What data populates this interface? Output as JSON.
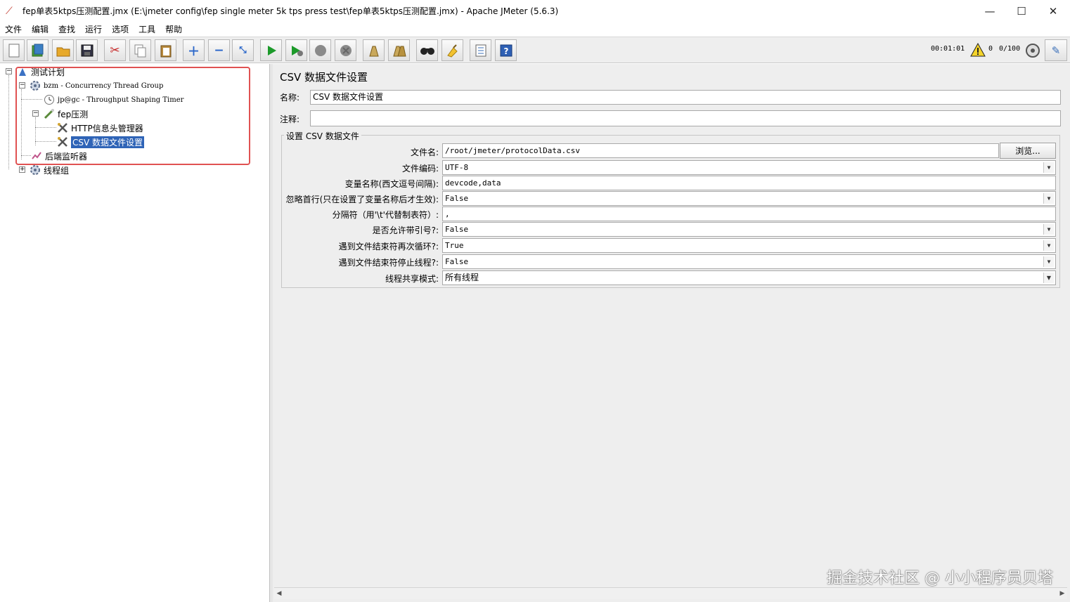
{
  "window": {
    "title": "fep单表5ktps压测配置.jmx (E:\\jmeter config\\fep single meter 5k tps press test\\fep单表5ktps压测配置.jmx) - Apache JMeter (5.6.3)",
    "minimize": "—",
    "maximize": "☐",
    "close": "✕"
  },
  "menu": [
    "文件",
    "编辑",
    "查找",
    "运行",
    "选项",
    "工具",
    "帮助"
  ],
  "toolbar": {
    "buttons": [
      "new-icon",
      "templates-icon",
      "open-icon",
      "save-icon",
      "cut-icon",
      "copy-icon",
      "paste-icon",
      "expand-icon",
      "collapse-icon",
      "toggle-icon",
      "start-icon",
      "start-no-pause-icon",
      "stop-icon",
      "shutdown-icon",
      "clear-icon",
      "clear-all-icon",
      "search-icon",
      "reset-search-icon",
      "function-helper-icon",
      "help-icon"
    ],
    "elapsed_time": "00:01:01",
    "warnings": "0",
    "threads": "0/100"
  },
  "tree": {
    "test_plan": "测试计划",
    "thread_group": "bzm - Concurrency Thread Group",
    "timer": "jp@gc - Throughput Shaping Timer",
    "controller": "fep压测",
    "header_manager": "HTTP信息头管理器",
    "csv_config": "CSV 数据文件设置",
    "backend_listener": "后端监听器",
    "thread_group2": "线程组"
  },
  "panel": {
    "title": "CSV 数据文件设置",
    "name_label": "名称:",
    "name_value": "CSV 数据文件设置",
    "comment_label": "注释:",
    "comment_value": "",
    "group_title": "设置 CSV 数据文件",
    "browse": "浏览...",
    "fields": [
      {
        "label": "文件名:",
        "value": "/root/jmeter/protocolData.csv",
        "type": "text"
      },
      {
        "label": "文件编码:",
        "value": "UTF-8",
        "type": "select"
      },
      {
        "label": "变量名称(西文逗号间隔):",
        "value": "devcode,data",
        "type": "text"
      },
      {
        "label": "忽略首行(只在设置了变量名称后才生效):",
        "value": "False",
        "type": "select"
      },
      {
        "label": "分隔符（用'\\t'代替制表符）:",
        "value": ",",
        "type": "text"
      },
      {
        "label": "是否允许带引号?:",
        "value": "False",
        "type": "select"
      },
      {
        "label": "遇到文件结束符再次循环?:",
        "value": "True",
        "type": "select"
      },
      {
        "label": "遇到文件结束符停止线程?:",
        "value": "False",
        "type": "select"
      },
      {
        "label": "线程共享模式:",
        "value": "所有线程",
        "type": "select"
      }
    ]
  },
  "watermark": "掘金技术社区 @ 小小程序员贝塔"
}
